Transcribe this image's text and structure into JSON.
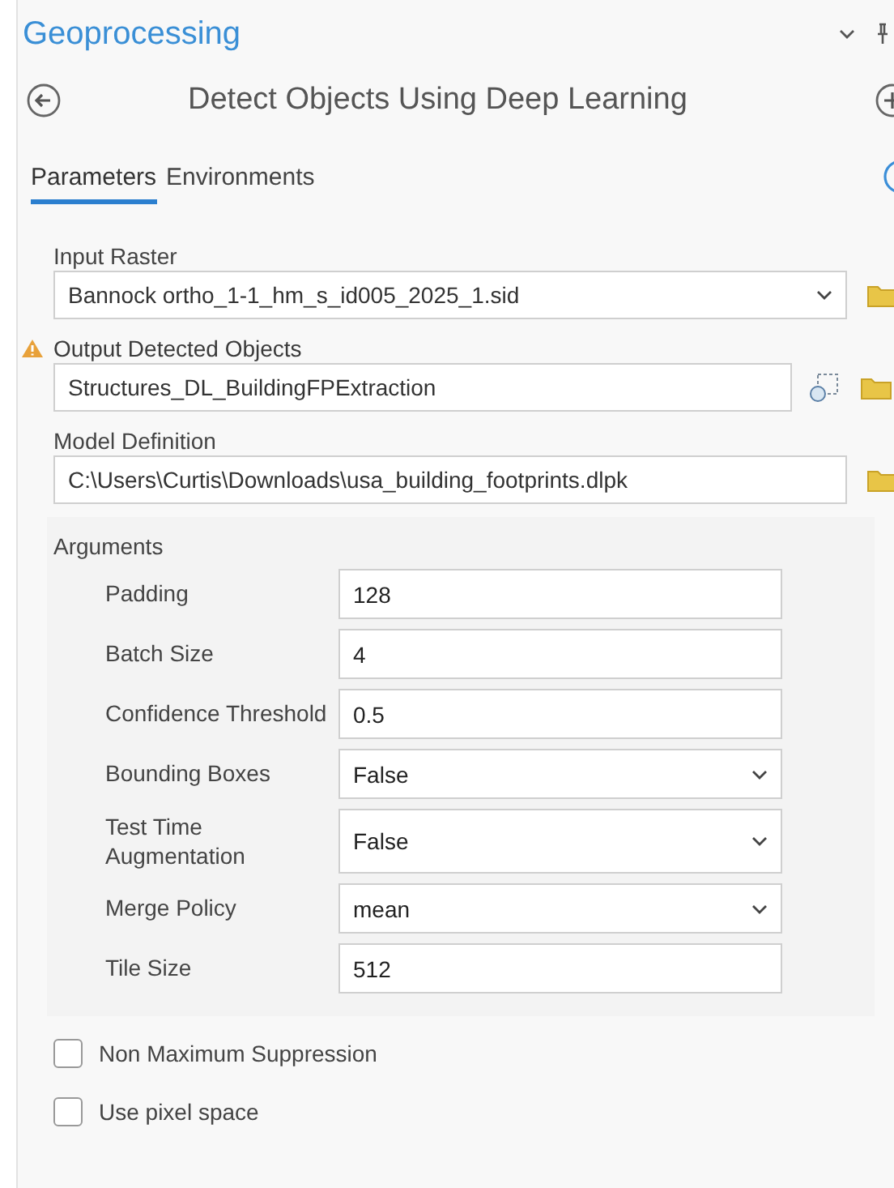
{
  "pane": {
    "title": "Geoprocessing"
  },
  "tool": {
    "title": "Detect Objects Using Deep Learning"
  },
  "tabs": [
    {
      "label": "Parameters",
      "selected": true
    },
    {
      "label": "Environments",
      "selected": false
    }
  ],
  "parameters": [
    {
      "label": "Input Raster",
      "value": "Bannock ortho_1-1_hm_s_id005_2025_1.sid",
      "kind": "dropdown",
      "warning": false
    },
    {
      "label": "Output Detected Objects",
      "value": "Structures_DL_BuildingFPExtraction",
      "kind": "output",
      "warning": true
    },
    {
      "label": "Model Definition",
      "value": "C:\\Users\\Curtis\\Downloads\\usa_building_footprints.dlpk",
      "kind": "file",
      "warning": false
    }
  ],
  "arguments": {
    "title": "Arguments",
    "rows": [
      {
        "label": "Padding",
        "value": "128",
        "kind": "text"
      },
      {
        "label": "Batch Size",
        "value": "4",
        "kind": "text"
      },
      {
        "label": "Confidence Threshold",
        "value": "0.5",
        "kind": "text"
      },
      {
        "label": "Bounding Boxes",
        "value": "False",
        "kind": "dropdown"
      },
      {
        "label": "Test Time Augmentation",
        "value": "False",
        "kind": "dropdown"
      },
      {
        "label": "Merge Policy",
        "value": "mean",
        "kind": "dropdown"
      },
      {
        "label": "Tile Size",
        "value": "512",
        "kind": "text"
      }
    ]
  },
  "options": [
    {
      "label": "Non Maximum Suppression",
      "checked": false
    },
    {
      "label": "Use pixel space",
      "checked": false
    }
  ]
}
